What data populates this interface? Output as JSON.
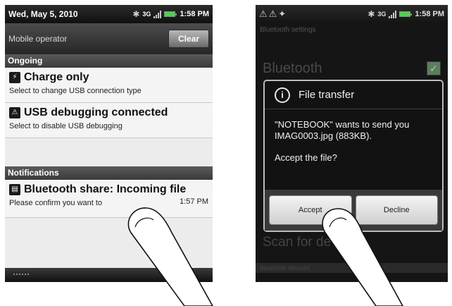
{
  "left_phone": {
    "status_bar": {
      "date": "Wed, May 5, 2010",
      "time": "1:58 PM"
    },
    "operator_bar": {
      "operator": "Mobile operator",
      "clear_label": "Clear"
    },
    "sections": {
      "ongoing": "Ongoing",
      "notifications": "Notifications"
    },
    "notifications": {
      "charge": {
        "title": "Charge only",
        "subtitle": "Select to change USB connection type"
      },
      "usb": {
        "title": "USB debugging connected",
        "subtitle": "Select to disable USB debugging"
      },
      "bluetooth": {
        "title": "Bluetooth share: Incoming file",
        "subtitle": "Please confirm you want to",
        "time": "1:57 PM"
      }
    }
  },
  "right_phone": {
    "status_bar": {
      "time": "1:58 PM"
    },
    "settings_header": "Bluetooth settings",
    "bluetooth_label": "Bluetooth",
    "dialog": {
      "title": "File transfer",
      "message": "\"NOTEBOOK\" wants to send you IMAG0003.jpg (883KB).",
      "question": "Accept the file?",
      "accept": "Accept",
      "decline": "Decline"
    },
    "scan_label": "Scan for de",
    "section_label": "Bluetooth devices"
  },
  "colors": {
    "status_bar": "#141414",
    "notification_bg": "#f4f4f4",
    "section_bar": "#444444",
    "dialog_bg": "#121212",
    "battery": "#4fd04f"
  }
}
